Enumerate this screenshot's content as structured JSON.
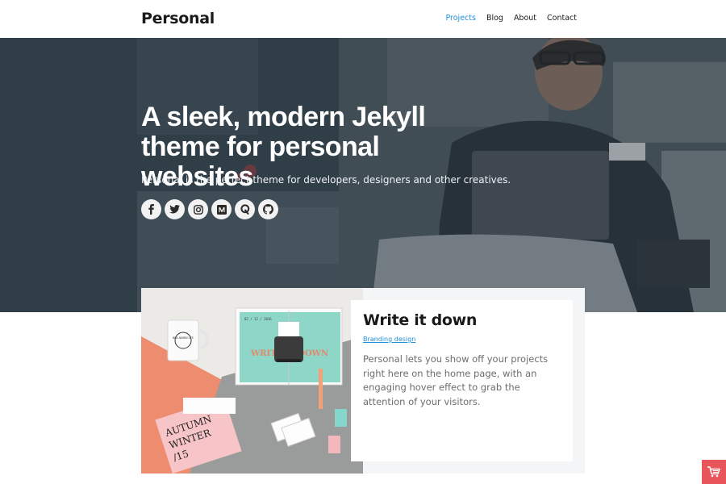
{
  "header": {
    "brand": "Personal",
    "nav": [
      {
        "label": "Projects",
        "active": true
      },
      {
        "label": "Blog",
        "active": false
      },
      {
        "label": "About",
        "active": false
      },
      {
        "label": "Contact",
        "active": false
      }
    ]
  },
  "hero": {
    "title": "A sleek, modern Jekyll theme for personal websites",
    "subtitle": "Personal is the perfect theme for developers, designers and other creatives.",
    "socials": [
      {
        "icon": "facebook-icon",
        "glyph": "f"
      },
      {
        "icon": "twitter-icon",
        "glyph": ""
      },
      {
        "icon": "instagram-icon",
        "glyph": ""
      },
      {
        "icon": "medium-icon",
        "glyph": "M"
      },
      {
        "icon": "quora-icon",
        "glyph": "Q"
      },
      {
        "icon": "github-icon",
        "glyph": ""
      }
    ]
  },
  "project": {
    "title": "Write it down",
    "tag": "Branding design",
    "description": "Personal lets you show off your projects right here on the home page, with an engaging hover effect to grab the attention of your visitors.",
    "image_texts": {
      "mug": "BRA NDMIN UTE",
      "date": "02 / 12 / 2016",
      "headline": "WRITE IT DOWN",
      "flyer_line1": "AUTUMN",
      "flyer_line2": "WINTER",
      "flyer_line3": "/15"
    }
  },
  "colors": {
    "accent": "#1f8fd6",
    "cart": "#e8555a",
    "hero_tint": "#3f4b54"
  },
  "cart": {
    "icon": "shopping-cart-icon"
  }
}
